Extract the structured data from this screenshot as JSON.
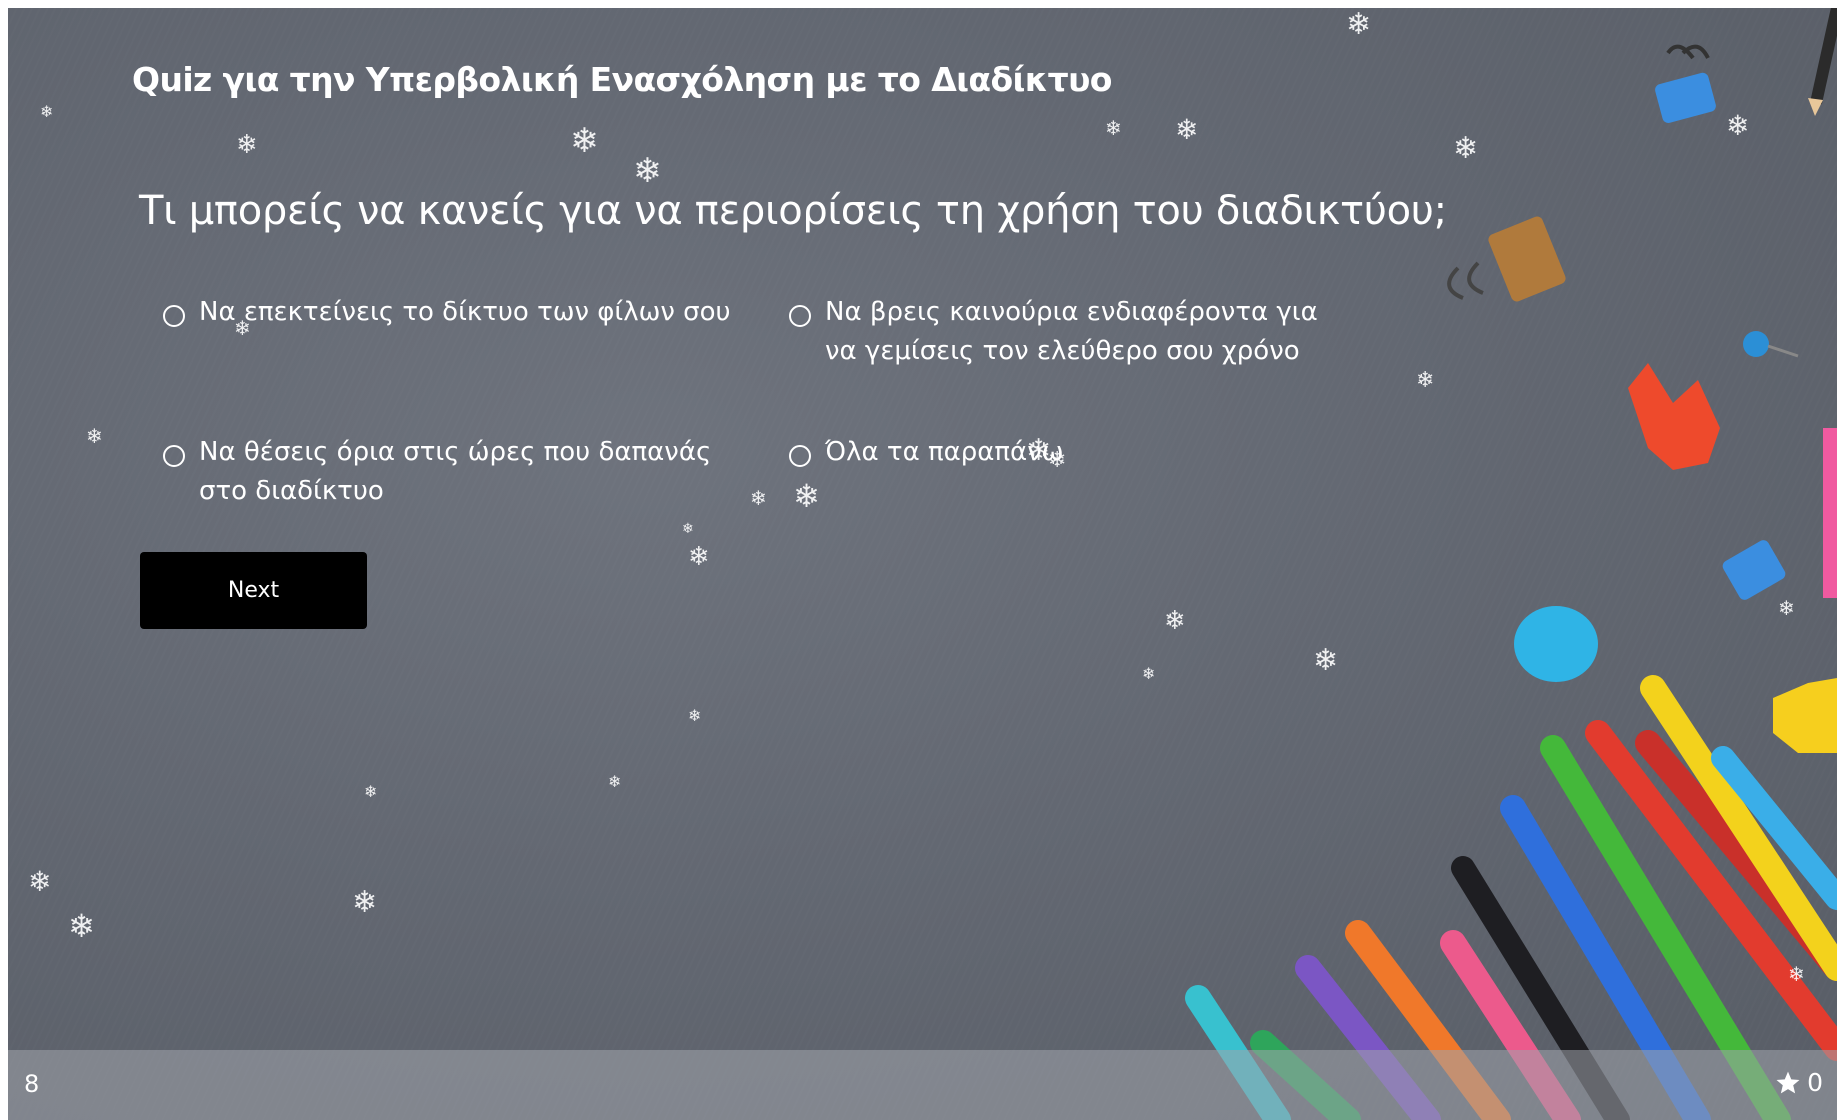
{
  "quiz": {
    "title": "Quiz για την Υπερβολική Ενασχόληση με το Διαδίκτυο",
    "question": "Τι μπορείς να κανείς για να περιορίσεις τη χρήση του διαδικτύου;",
    "options": [
      {
        "label": "Να επεκτείνεις το δίκτυο των φίλων σου"
      },
      {
        "label": "Να βρεις καινούρια ενδιαφέροντα για να γεμίσεις τον ελεύθερο σου χρόνο"
      },
      {
        "label": "Να θέσεις όρια στις ώρες που δαπανάς στο διαδίκτυο"
      },
      {
        "label": "Όλα τα παραπάνω"
      }
    ],
    "next_label": "Next"
  },
  "footer": {
    "page_number": "8",
    "score": "0",
    "score_icon": "star-icon"
  },
  "colors": {
    "background": "#62676f",
    "button": "#000000",
    "text": "#ffffff",
    "footer_bar": "#9ea2aa"
  },
  "decorations": {
    "snowflake_icon": "snowflake-icon",
    "snowflake_glyph": "❄"
  }
}
